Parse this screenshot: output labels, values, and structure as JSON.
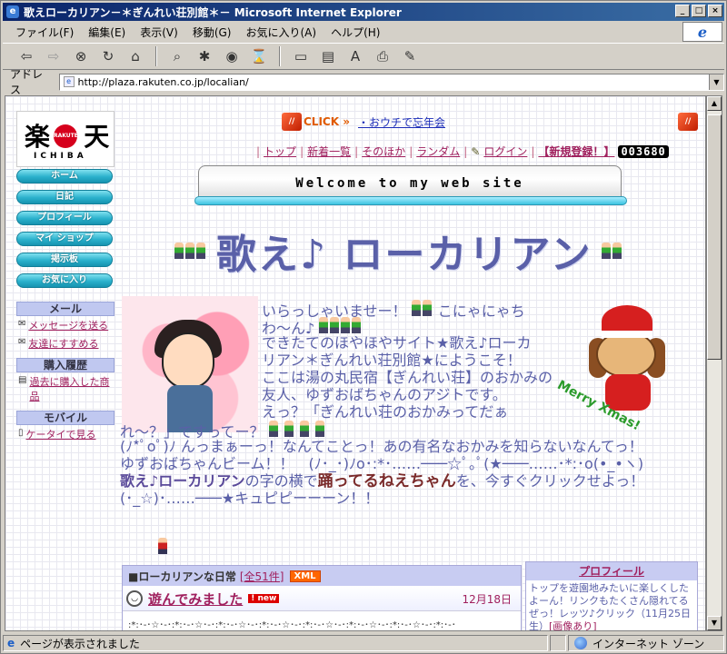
{
  "window": {
    "title": "歌えローカリアン－＊ぎんれい荘別館＊－ Microsoft Internet Explorer"
  },
  "menu": [
    "ファイル(F)",
    "編集(E)",
    "表示(V)",
    "移動(G)",
    "お気に入り(A)",
    "ヘルプ(H)"
  ],
  "address": {
    "label": "アドレス",
    "url": "http://plaza.rakuten.co.jp/localian/"
  },
  "status": {
    "text": "ページが表示されました",
    "zone": "インターネット ゾーン"
  },
  "logo": {
    "main": "楽",
    "main2": "天",
    "dot": "RAKUTEN",
    "sub": "ICHIBA"
  },
  "nav": [
    "ホーム",
    "日記",
    "プロフィール",
    "マイ ショップ",
    "掲示板",
    "お気に入り"
  ],
  "sidebar": {
    "mail_heading": "メール",
    "send_message": "メッセージを送る",
    "recommend": "友達にすすめる",
    "history_heading": "購入履歴",
    "past_items": "過去に購入した商品",
    "mobile_heading": "モバイル",
    "mobile_link": "ケータイで見る"
  },
  "click_banner": {
    "click": "CLICK",
    "link": "・おウチで忘年会"
  },
  "toplinks": [
    "トップ",
    "新着一覧",
    "そのほか",
    "ランダム",
    "ログイン",
    "【新規登録！】"
  ],
  "counter": "003680",
  "welcome": "Welcome to my web site",
  "site_title": "歌え♪ ローカリアン",
  "intro_lines": [
    "いらっしゃいませー！",
    "こにゃにゃち",
    "わ～ん♪",
    "できたてのほやほやサイト★歌え♪ローカ",
    "リアン＊ぎんれい荘別館★にようこそ！",
    "ここは湯の丸民宿【ぎんれい荘】のおかみの",
    "友人、ゆずおばちゃんのアジトです。",
    "えっ？「ぎんれい荘のおかみってだぁ",
    "れ～？」ですってー？",
    "(ﾉ*ﾟoﾟ)ﾉ んっまぁーっ！なんてことっ！あの有名なおかみを知らないなんてっ！",
    "ゆずおばちゃんビーム！！　(ﾉ･_･)ﾉo･:*･……───☆ﾟ｡ﾟ(★───……･*:･o(•_•ヽ)",
    "歌え♪ローカリアン",
    "の字の横で",
    "踊ってるねえちゃん",
    "を、今すぐクリックせよっ！",
    "(･_☆)･……───★キュピピーーーン！！"
  ],
  "xmas": "Merry Xmas!",
  "diary": {
    "heading": "■ローカリアンな日常",
    "count": "[全51件]",
    "xml": "XML",
    "entry_title": "遊んでみました",
    "new": "new",
    "date": "12月18日",
    "deco": ":*:･-･☆･-･:*:･-･☆･-･:*:･-･☆･-･:*:･-･☆･-･:*:･-･☆･-･:*:･-･☆･-･:*:･-･☆･-･:*:･-･"
  },
  "profile": {
    "heading": "プロフィール",
    "body1": "トップを遊園地みたいに楽しくしたよーん！リンクもたくさん隠れてるぜっ！レッツ♪クリック（11月25日生）",
    "body2": "[画像あり]"
  },
  "colors": {
    "accent": "#5a60a8",
    "link": "#a0205e",
    "nav_button": "#2ab1cc"
  }
}
